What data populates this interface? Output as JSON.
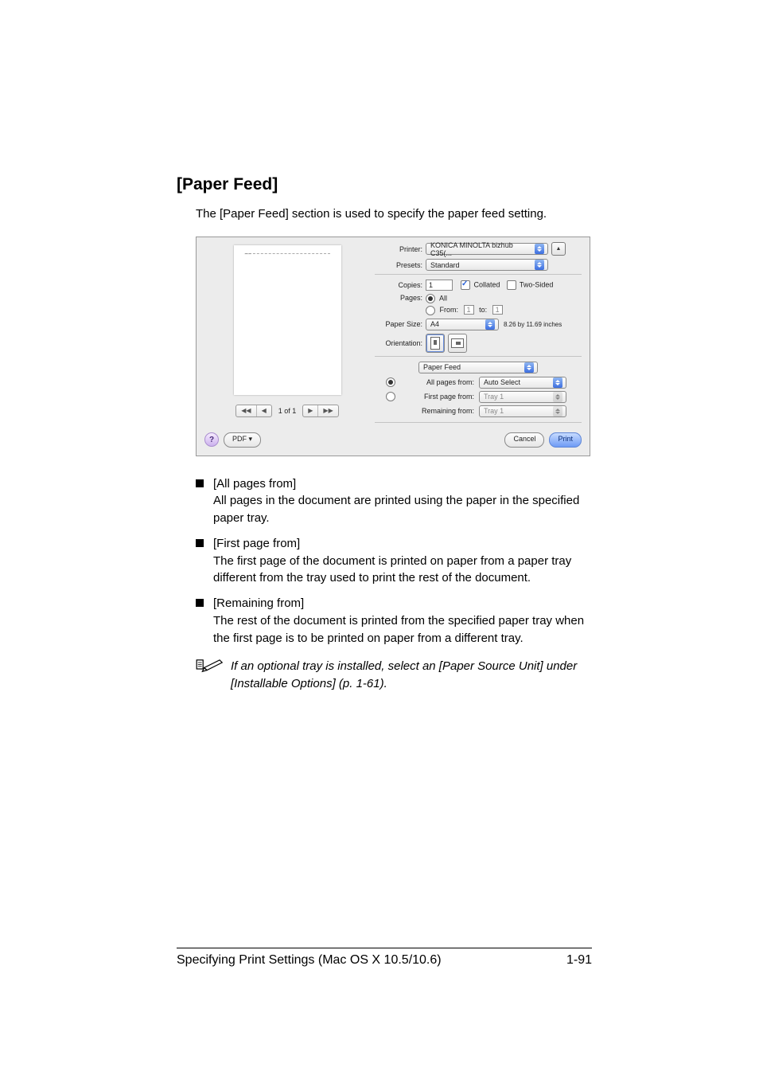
{
  "heading": "[Paper Feed]",
  "intro": "The [Paper Feed] section is used to specify the paper feed setting.",
  "dialog": {
    "preview_pager_label": "1 of 1",
    "printer_label": "Printer:",
    "printer_value": "KONICA MINOLTA bizhub C35(...",
    "presets_label": "Presets:",
    "presets_value": "Standard",
    "copies_label": "Copies:",
    "copies_value": "1",
    "collated_label": "Collated",
    "two_sided_label": "Two-Sided",
    "pages_label": "Pages:",
    "pages_all": "All",
    "pages_from_label": "From:",
    "pages_from": "1",
    "pages_to_label": "to:",
    "pages_to": "1",
    "paper_size_label": "Paper Size:",
    "paper_size_value": "A4",
    "paper_size_dim": "8.26 by 11.69 inches",
    "orientation_label": "Orientation:",
    "section_value": "Paper Feed",
    "all_pages_label": "All pages from:",
    "all_pages_value": "Auto Select",
    "first_page_label": "First page from:",
    "first_page_value": "Tray 1",
    "remaining_label": "Remaining from:",
    "remaining_value": "Tray 1",
    "pdf_label": "PDF ▾",
    "cancel": "Cancel",
    "print": "Print"
  },
  "bullets": {
    "b1_title": "[All pages from]",
    "b1_text": "All pages in the document are printed using the paper in the specified paper tray.",
    "b2_title": "[First page from]",
    "b2_text": "The first page of the document is printed on paper from a paper tray different from the tray used to print the rest of the document.",
    "b3_title": "[Remaining from]",
    "b3_text": "The rest of the document is printed from the specified paper tray when the first page is to be printed on paper from a different tray."
  },
  "note": "If an optional tray is installed, select an [Paper Source Unit] under [Installable Options] (p. 1-61).",
  "footer_left": "Specifying Print Settings (Mac OS X 10.5/10.6)",
  "footer_right": "1-91"
}
